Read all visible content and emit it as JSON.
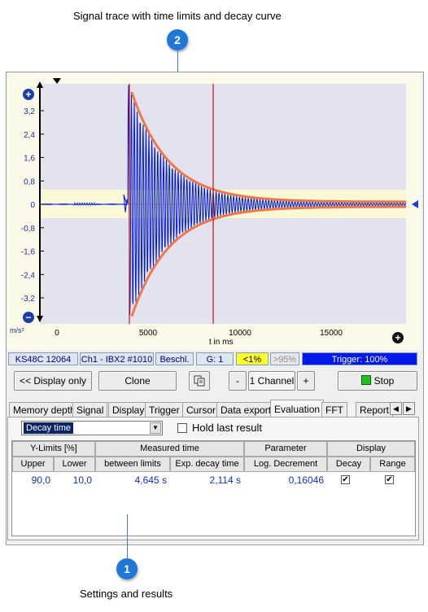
{
  "callouts": {
    "top": {
      "number": "2",
      "text": "Signal trace with time limits and decay curve"
    },
    "bottom": {
      "number": "1",
      "text": "Settings and results"
    }
  },
  "plot": {
    "y_unit": "m/s²",
    "x_label": "t in ms",
    "y_ticks": [
      "3,2",
      "2,4",
      "1,6",
      "0,8",
      "0",
      "-0,8",
      "-1,6",
      "-2,4",
      "-3,2"
    ],
    "x_ticks": [
      "0",
      "5000",
      "10000",
      "15000"
    ],
    "colors": {
      "signal": "#0018d8",
      "envelope": "#f07848",
      "limits": "#c01818",
      "plot_bg": "#e3e3f0",
      "band": "#fbf8d6"
    }
  },
  "statusbar": {
    "sensor": "KS48C 12064",
    "channel": "Ch1 - IBX2 #1010",
    "quantity": "Beschl.",
    "gain": "G: 1",
    "level_low": "<1%",
    "level_high": ">95%",
    "trigger": "Trigger: 100%"
  },
  "toolbar": {
    "display_only": "<< Display only",
    "clone": "Clone",
    "minus": "-",
    "channels": "1 Channel",
    "plus": "+",
    "stop": "Stop"
  },
  "tabs": [
    "Memory depth",
    "Signal",
    "Display",
    "Trigger",
    "Cursor",
    "Data export",
    "Evaluation",
    "FFT",
    "Report"
  ],
  "evaluation": {
    "mode_select": "Decay time",
    "hold_label": "Hold last result",
    "group_headers": [
      "Y-Limits [%]",
      "Measured time",
      "Parameter",
      "Display"
    ],
    "columns": [
      "Upper",
      "Lower",
      "between limits",
      "Exp. decay time",
      "Log. Decrement",
      "Decay",
      "Range"
    ],
    "row": {
      "upper": "90,0",
      "lower": "10,0",
      "between": "4,645 s",
      "exp_decay": "2,114 s",
      "log_dec": "0,16046",
      "decay_checked": "✔",
      "range_checked": "✔"
    }
  }
}
